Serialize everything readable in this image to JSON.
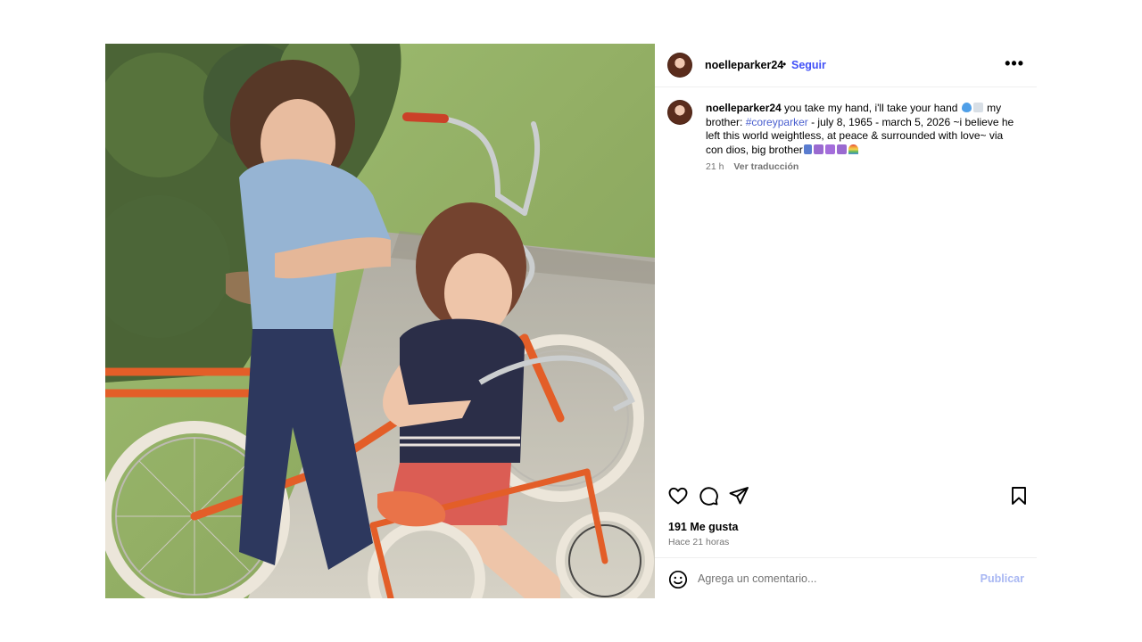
{
  "post": {
    "username": "noelleparker24",
    "follow_label": "Seguir",
    "more_label": "•••",
    "caption": {
      "username": "noelleparker24",
      "text_1": " you take my hand, i'll take your hand ",
      "text_2": " my brother: ",
      "hashtag": "#coreyparker",
      "text_3": " - july 8, 1965 - march 5, 2026 ~i believe he left this world weightless, at peace & surrounded with love~ via con dios, big brother",
      "emojis": [
        "blue-heart",
        "dove",
        "person-blue",
        "pisces",
        "heart-box",
        "peace",
        "rainbow"
      ]
    },
    "time": "21 h",
    "translate_label": "Ver traducción",
    "likes": "191 Me gusta",
    "posted_ago": "Hace 21 horas",
    "comment_placeholder": "Agrega un comentario...",
    "publish_label": "Publicar"
  },
  "icons": {
    "actions": [
      "heart-icon",
      "comment-icon",
      "share-icon",
      "bookmark-icon"
    ],
    "emoji_picker": "smiley-icon"
  },
  "colors": {
    "link_blue": "#4150f7",
    "secondary_text": "#737373",
    "publish_disabled": "#a8b7f3"
  }
}
